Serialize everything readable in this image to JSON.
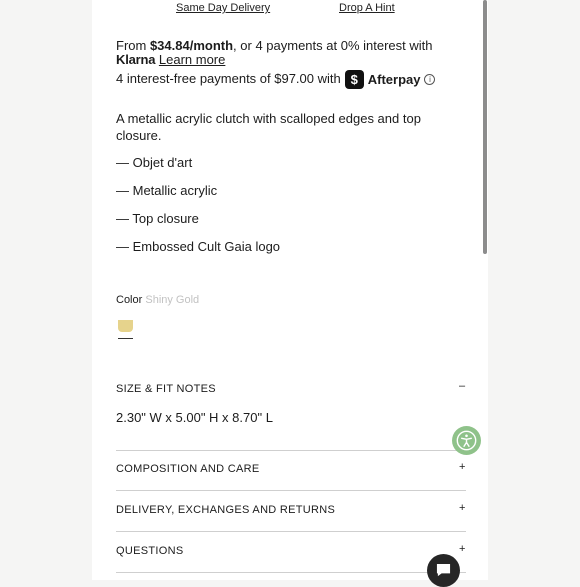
{
  "links": {
    "same_day_delivery": "Same Day Delivery",
    "drop_a_hint": "Drop A Hint"
  },
  "payments": {
    "klarna_prefix": "From ",
    "klarna_amount": "$34.84/month",
    "klarna_suffix": ", or 4 payments at 0% interest with",
    "klarna_brand": "Klarna",
    "klarna_learn_more": "Learn more",
    "afterpay_text": "4 interest-free payments of $97.00 with",
    "afterpay_brand": "Afterpay",
    "afterpay_badge_glyph": "$",
    "info_glyph": "i"
  },
  "description": {
    "text": "A metallic acrylic clutch with scalloped edges and top closure.",
    "bullets": [
      "— Objet d'art",
      "— Metallic acrylic",
      "— Top closure",
      "— Embossed Cult Gaia logo"
    ]
  },
  "color": {
    "label": "Color",
    "value": "Shiny Gold",
    "swatch_hex": "#e6d38c"
  },
  "accordions": [
    {
      "title": "SIZE & FIT NOTES",
      "toggle": "–",
      "content": "2.30\" W x 5.00\" H x 8.70\" L"
    },
    {
      "title": "COMPOSITION AND CARE",
      "toggle": "+"
    },
    {
      "title": "DELIVERY, EXCHANGES AND RETURNS",
      "toggle": "+"
    },
    {
      "title": "QUESTIONS",
      "toggle": "+"
    }
  ],
  "icons": {
    "accessibility": "accessibility-icon",
    "chat": "chat-icon"
  }
}
